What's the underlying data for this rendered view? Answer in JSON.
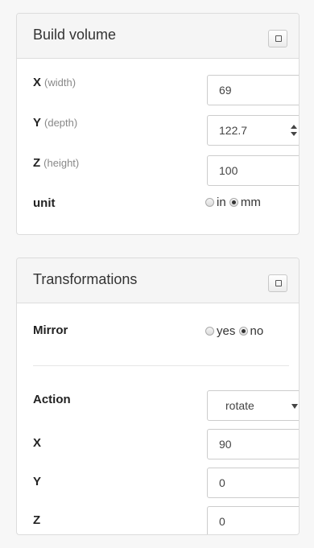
{
  "build_volume": {
    "title": "Build volume",
    "x": {
      "label": "X",
      "sub": "(width)",
      "value": "69"
    },
    "y": {
      "label": "Y",
      "sub": "(depth)",
      "value": "122.7"
    },
    "z": {
      "label": "Z",
      "sub": "(height)",
      "value": "100"
    },
    "unit": {
      "label": "unit",
      "options": [
        "in",
        "mm"
      ],
      "selected": "mm"
    }
  },
  "transformations": {
    "title": "Transformations",
    "mirror": {
      "label": "Mirror",
      "options": [
        "yes",
        "no"
      ],
      "selected": "no"
    },
    "action": {
      "label": "Action",
      "value": "rotate"
    },
    "x": {
      "label": "X",
      "value": "90"
    },
    "y": {
      "label": "Y",
      "value": "0"
    },
    "z": {
      "label": "Z",
      "value": "0"
    }
  }
}
